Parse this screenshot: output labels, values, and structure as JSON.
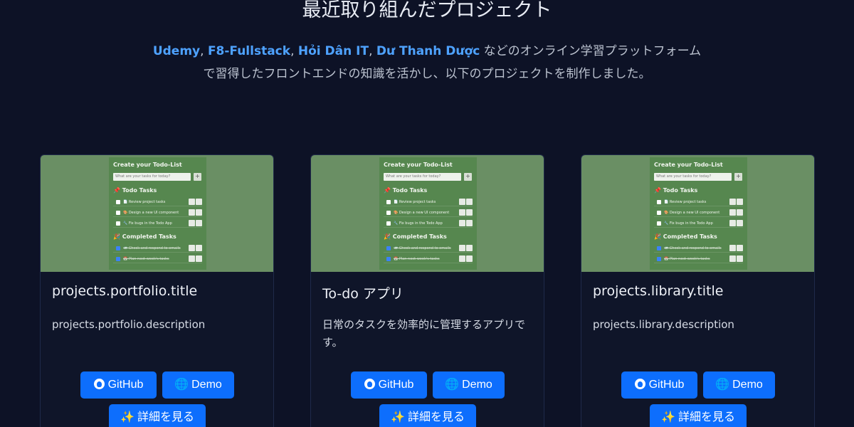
{
  "section": {
    "title": "最近取り組んだプロジェクト",
    "intro": {
      "platforms": [
        "Udemy",
        "F8-Fullstack",
        "Hỏi Dân IT",
        "Dư Thanh Dược"
      ],
      "separator": ", ",
      "line1_rest": " などのオンライン学習プラットフォーム",
      "line2": "で習得したフロントエンドの知識を活かし、以下のプロジェクトを制作しました。"
    }
  },
  "thumbnail": {
    "title": "Create your Todo-List",
    "placeholder": "What are your tasks for today?",
    "add": "+",
    "todo_heading": "📌 Todo Tasks",
    "todo_items": [
      "📄 Review project tasks",
      "🎨 Design a new UI component",
      "🔧 Fix bugs in the Todo App"
    ],
    "completed_heading": "🎉 Completed Tasks",
    "completed_items": [
      "📨 Check and respond to emails",
      "📅 Plan next week's tasks"
    ]
  },
  "projects": [
    {
      "title": "projects.portfolio.title",
      "description": "projects.portfolio.description",
      "github_label": "GitHub",
      "demo_label": "Demo",
      "detail_label": "詳細を見る"
    },
    {
      "title": "To-do アプリ",
      "description": "日常のタスクを効率的に管理するアプリです。",
      "github_label": "GitHub",
      "demo_label": "Demo",
      "detail_label": "詳細を見る"
    },
    {
      "title": "projects.library.title",
      "description": "projects.library.description",
      "github_label": "GitHub",
      "demo_label": "Demo",
      "detail_label": "詳細を見る"
    }
  ],
  "icons": {
    "github": "github-icon",
    "demo": "globe-icon",
    "detail": "sparkles-icon"
  },
  "colors": {
    "background": "#0d1226",
    "card": "#0f1529",
    "accent_link": "#4ea2ff",
    "button": "#0d6efd",
    "thumbnail": "#6a8f64"
  }
}
